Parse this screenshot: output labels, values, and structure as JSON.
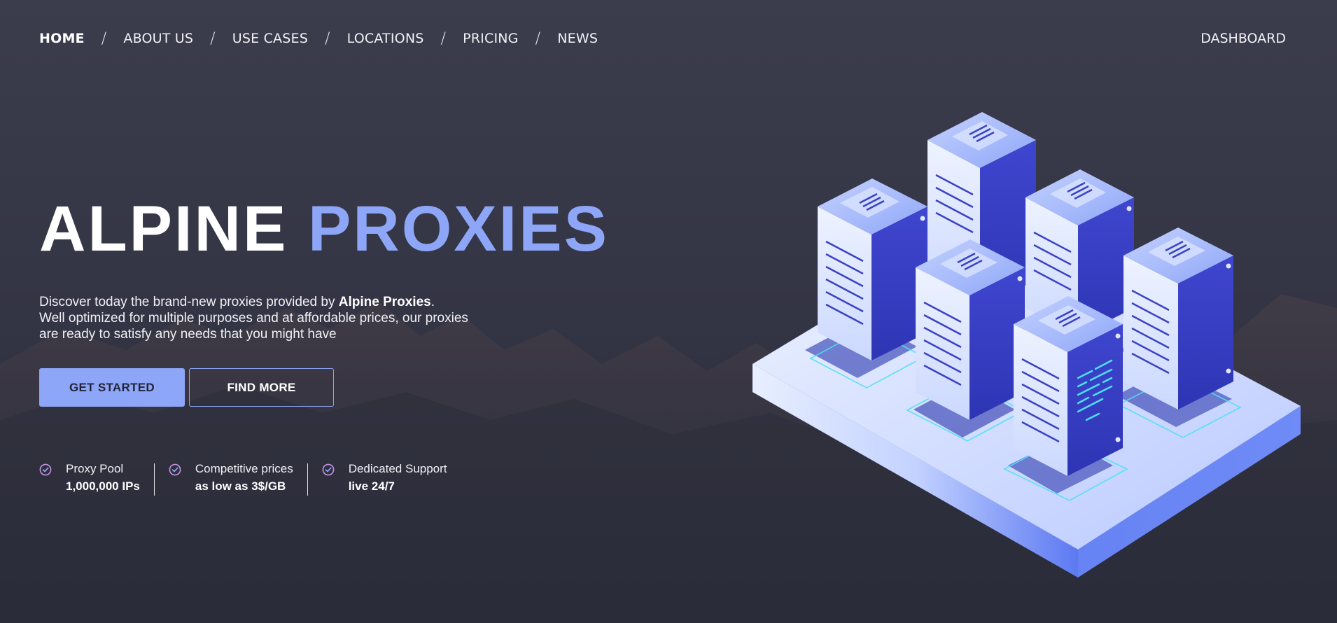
{
  "nav": {
    "items": [
      {
        "label": "HOME",
        "active": true
      },
      {
        "label": "ABOUT US",
        "active": false
      },
      {
        "label": "USE CASES",
        "active": false
      },
      {
        "label": "LOCATIONS",
        "active": false
      },
      {
        "label": "PRICING",
        "active": false
      },
      {
        "label": "NEWS",
        "active": false
      }
    ],
    "separator": "/",
    "dashboard": "DASHBOARD"
  },
  "hero": {
    "title_part1": "ALPINE",
    "title_part2": "PROXIES",
    "desc_part1": "Discover today the brand-new proxies provided by ",
    "desc_brand": "Alpine Proxies",
    "desc_part2": ".",
    "desc_line2": "Well optimized for multiple purposes and at affordable prices, our proxies are ready to satisfy any needs that you might have",
    "primary_button": "GET STARTED",
    "secondary_button": "FIND MORE"
  },
  "features": [
    {
      "title": "Proxy Pool",
      "value": "1,000,000 IPs",
      "icon": "check-circle-icon"
    },
    {
      "title": "Competitive prices",
      "value": "as low as 3$/GB",
      "icon": "check-circle-icon"
    },
    {
      "title": "Dedicated Support",
      "value": "live 24/7",
      "icon": "check-circle-icon"
    }
  ],
  "colors": {
    "background": "#353646",
    "accent": "#8ea6f7",
    "server_dark": "#3a41c4",
    "server_light": "#dfe8ff",
    "glow": "#4ee0f5"
  },
  "illustration": "isometric-server-racks"
}
